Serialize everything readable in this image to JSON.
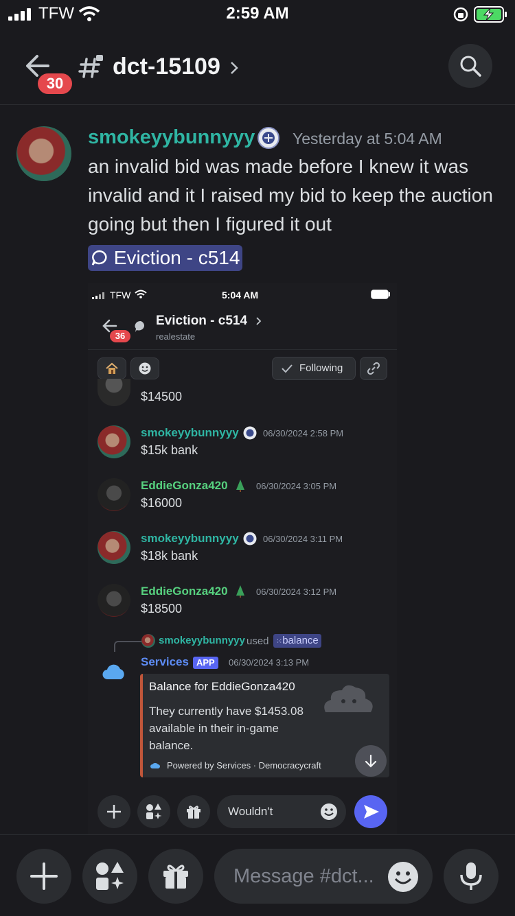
{
  "status_bar": {
    "carrier": "TFW",
    "time": "2:59 AM"
  },
  "header": {
    "back_badge": "30",
    "channel_name": "dct-15109"
  },
  "message": {
    "username": "smokeyybunnyyy",
    "timestamp": "Yesterday at 5:04 AM",
    "text": "an invalid bid was made before I knew it was invalid and it I raised my bid to keep the auction going but then I figured it out",
    "thread_link": "Eviction - c514"
  },
  "embed": {
    "status_bar": {
      "carrier": "TFW",
      "time": "5:04 AM"
    },
    "header": {
      "back_badge": "36",
      "title": "Eviction - c514",
      "subtitle": "realestate"
    },
    "following_label": "Following",
    "first_partial_text": "$14500",
    "messages": [
      {
        "username": "smokeyybunnyyy",
        "timestamp": "06/30/2024 2:58 PM",
        "text": "$15k bank"
      },
      {
        "username": "EddieGonza420",
        "timestamp": "06/30/2024 3:05 PM",
        "text": "$16000"
      },
      {
        "username": "smokeyybunnyyy",
        "timestamp": "06/30/2024 3:11 PM",
        "text": "$18k bank"
      },
      {
        "username": "EddieGonza420",
        "timestamp": "06/30/2024 3:12 PM",
        "text": "$18500"
      }
    ],
    "command": {
      "reply_user": "smokeyybunnyyy",
      "used_word": "used",
      "command_name": "balance",
      "bot_name": "Services",
      "app_tag": "APP",
      "timestamp": "06/30/2024 3:13 PM",
      "card_title": "Balance for EddieGonza420",
      "card_body": "They currently have $1453.08 available in their in-game balance.",
      "card_footer": "Powered by Services · Democracycraft"
    },
    "input_text": "Wouldn't"
  },
  "bottom_bar": {
    "placeholder": "Message #dct..."
  },
  "colors": {
    "accent": "#5865f2",
    "teal_name": "#2fb5a3",
    "green_name": "#57d17f",
    "badge": "#e5484d",
    "thread_pill": "#3e4585"
  }
}
